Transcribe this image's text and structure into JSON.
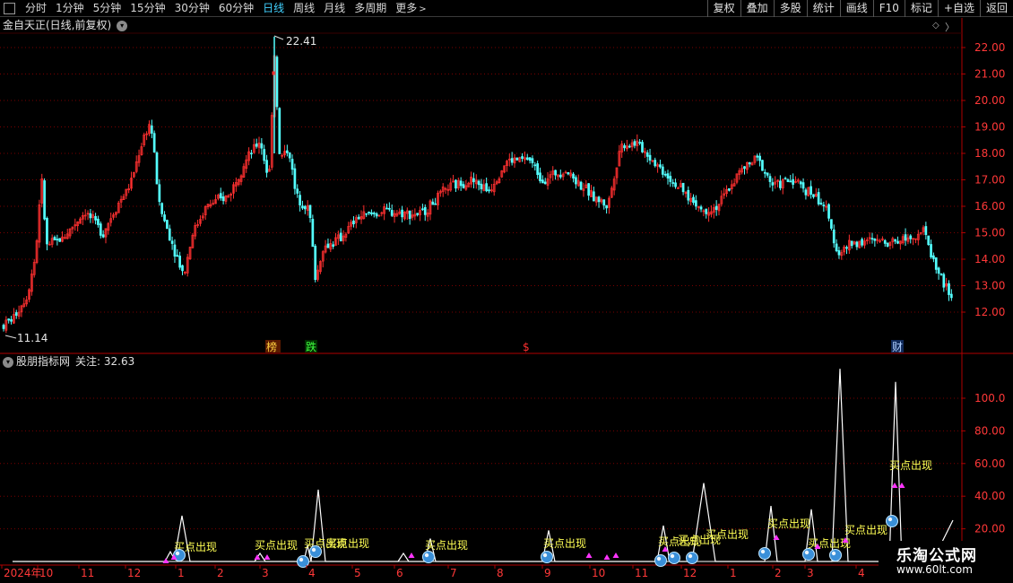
{
  "toolbar": {
    "periods": [
      "分时",
      "1分钟",
      "5分钟",
      "15分钟",
      "30分钟",
      "60分钟",
      "日线",
      "周线",
      "月线",
      "多周期"
    ],
    "active_period": "日线",
    "more_label": "更多",
    "right_buttons": [
      "复权",
      "叠加",
      "多股",
      "统计",
      "画线",
      "F10",
      "标记",
      "+自选",
      "返回"
    ]
  },
  "main_panel": {
    "title": "金自天正(日线,前复权)",
    "high_label": "22.41",
    "low_label": "11.14",
    "price_axis": [
      "22.00",
      "21.00",
      "20.00",
      "19.00",
      "18.00",
      "17.00",
      "16.00",
      "15.00",
      "14.00",
      "13.00",
      "12.00"
    ],
    "event_markers": [
      "榜",
      "跌",
      "$",
      "财"
    ]
  },
  "indicator_panel": {
    "name": "股朋指标网",
    "focus_label": "关注: 32.63",
    "axis": [
      "100.0",
      "80.00",
      "60.00",
      "40.00",
      "20.00"
    ],
    "signal_text": "买点出现"
  },
  "time_axis": [
    "2024年",
    "10",
    "11",
    "12",
    "1",
    "2",
    "3",
    "4",
    "5",
    "6",
    "7",
    "8",
    "9",
    "10",
    "11",
    "12",
    "1",
    "2",
    "3",
    "4"
  ],
  "watermark": {
    "name": "乐淘公式网",
    "url": "www.60lt.com"
  },
  "colors": {
    "up": "#ff3030",
    "down": "#54ffff",
    "grid": "#7a0000",
    "signal_text": "#ffff54",
    "marker": "#ff34ff",
    "active_period": "#41d1ff"
  }
}
